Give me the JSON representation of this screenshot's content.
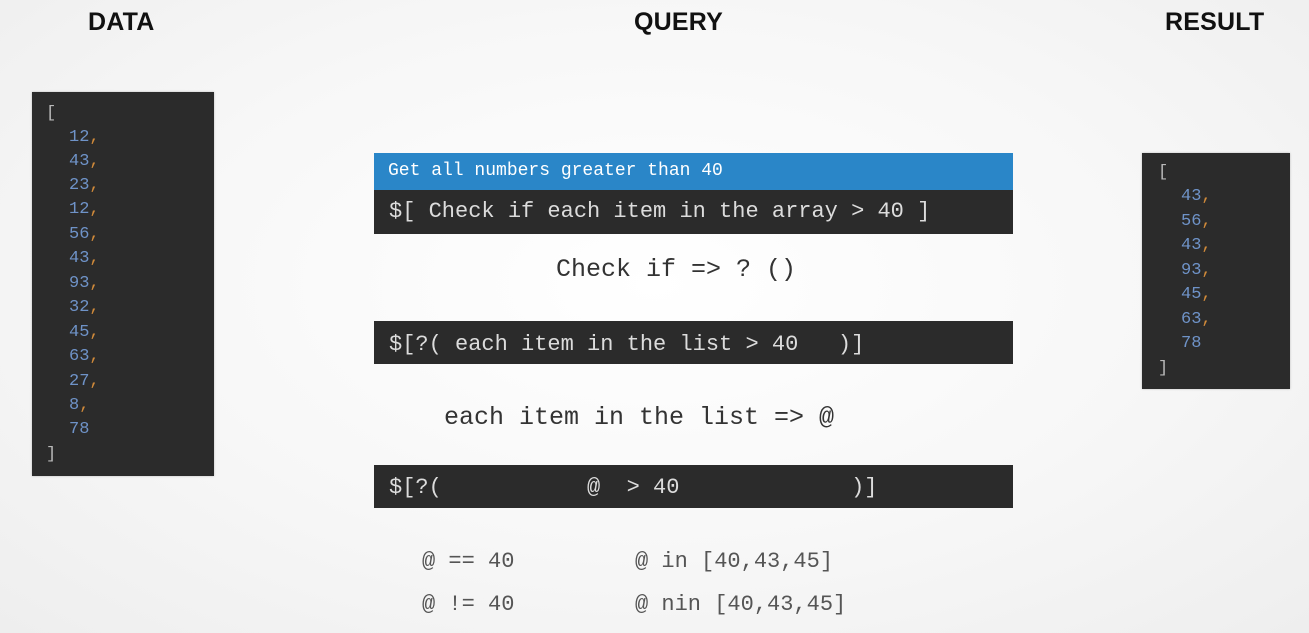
{
  "headings": {
    "data": "DATA",
    "query": "QUERY",
    "result": "RESULT"
  },
  "data_panel": {
    "open": "[",
    "values": [
      "12",
      "43",
      "23",
      "12",
      "56",
      "43",
      "93",
      "32",
      "45",
      "63",
      "27",
      "8",
      "78"
    ],
    "close": "]"
  },
  "result_panel": {
    "open": "[",
    "values": [
      "43",
      "56",
      "43",
      "93",
      "45",
      "63",
      "78"
    ],
    "close": "]"
  },
  "query": {
    "description": "Get all numbers greater than 40",
    "expression_1": "$[ Check if each item in the array > 40 ]",
    "note_1": "Check if => ? ()",
    "expression_2": "$[?( each item in the list > 40   )]",
    "note_2": "each item in the list => @",
    "expression_3": "$[?(           @  > 40             )]"
  },
  "operators": {
    "eq": "@ == 40",
    "neq": "@ != 40",
    "in": "@ in [40,43,45]",
    "nin": "@ nin [40,43,45]"
  },
  "colors": {
    "panel_background": "#2b2b2b",
    "description_bar": "#2a86c8",
    "number": "#6f93c8",
    "comma": "#d08a3a",
    "bracket": "#b9b9b9"
  }
}
